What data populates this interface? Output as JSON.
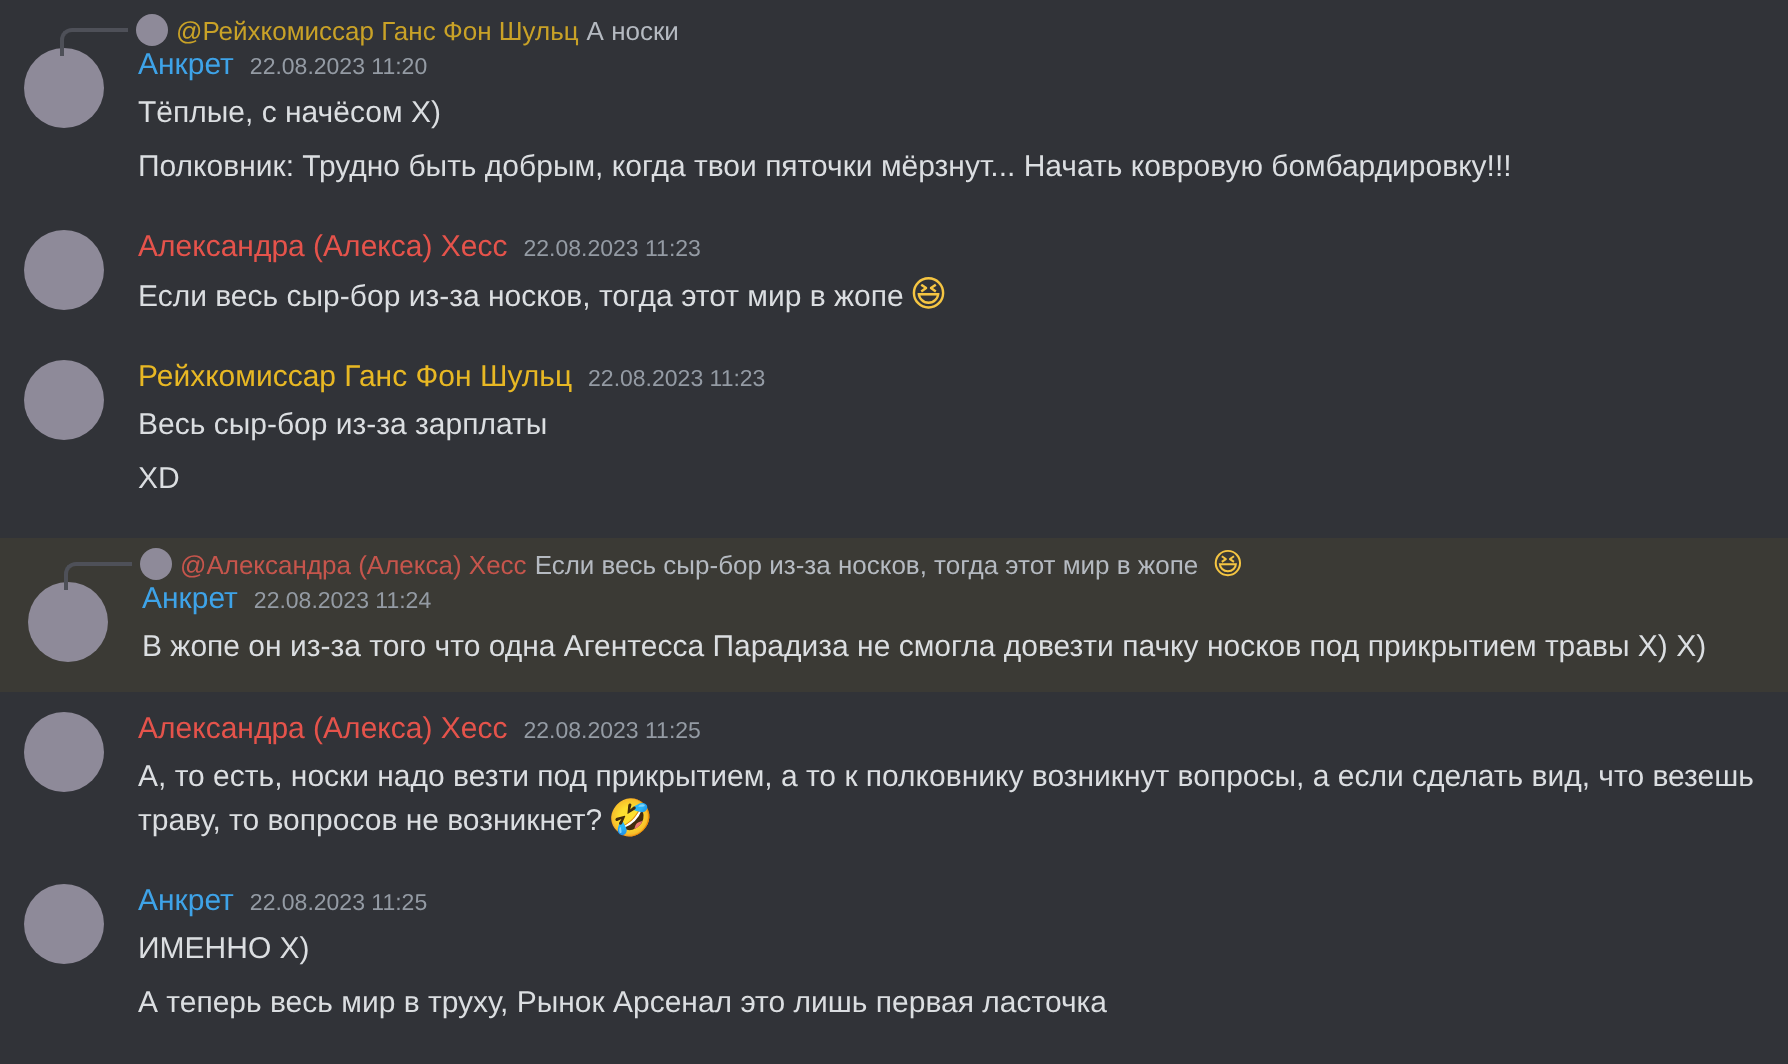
{
  "messages": [
    {
      "author": "Анкрет",
      "color": "#3ea3e8",
      "time": "22.08.2023 11:20",
      "highlighted": false,
      "reply": {
        "author": "@Рейхкомиссар Ганс Фон Шульц",
        "color": "#c9a227",
        "text": "А носки"
      },
      "lines": [
        {
          "text": "Тёплые, с начёсом X)"
        },
        {
          "text": "Полковник: Трудно быть добрым, когда твои пяточки мёрзнут... Начать ковровую бомбардировку!!!"
        }
      ]
    },
    {
      "author": "Александра (Алекса) Хесс",
      "color": "#e5534b",
      "time": "22.08.2023 11:23",
      "highlighted": false,
      "lines": [
        {
          "text": "Если весь сыр-бор из-за носков, тогда этот мир в жопе",
          "emoji": "😆"
        }
      ]
    },
    {
      "author": "Рейхкомиссар Ганс Фон Шульц",
      "color": "#e8b824",
      "time": "22.08.2023 11:23",
      "highlighted": false,
      "lines": [
        {
          "text": "Весь сыр-бор из-за зарплаты"
        },
        {
          "text": "XD"
        }
      ]
    },
    {
      "author": "Анкрет",
      "color": "#3ea3e8",
      "time": "22.08.2023 11:24",
      "highlighted": true,
      "reply": {
        "author": "@Александра (Алекса) Хесс",
        "color": "#c6554c",
        "text": "Если весь сыр-бор из-за носков, тогда этот мир в жопе",
        "emoji": "😆"
      },
      "lines": [
        {
          "text": "В жопе он из-за того что одна Агентесса Парадиза не смогла довезти пачку носков под прикрытием травы X) X)"
        }
      ]
    },
    {
      "author": "Александра (Алекса) Хесс",
      "color": "#e5534b",
      "time": "22.08.2023 11:25",
      "highlighted": false,
      "lines": [
        {
          "text": "А, то есть, носки надо везти под прикрытием, а то к полковнику возникнут вопросы, а если сделать вид, что везешь траву, то вопросов не возникнет?",
          "emoji": "🤣"
        }
      ]
    },
    {
      "author": "Анкрет",
      "color": "#3ea3e8",
      "time": "22.08.2023 11:25",
      "highlighted": false,
      "lines": [
        {
          "text": "ИМЕННО X)"
        },
        {
          "text": "А теперь весь мир в труху, Рынок Арсенал это лишь первая ласточка"
        }
      ]
    }
  ]
}
